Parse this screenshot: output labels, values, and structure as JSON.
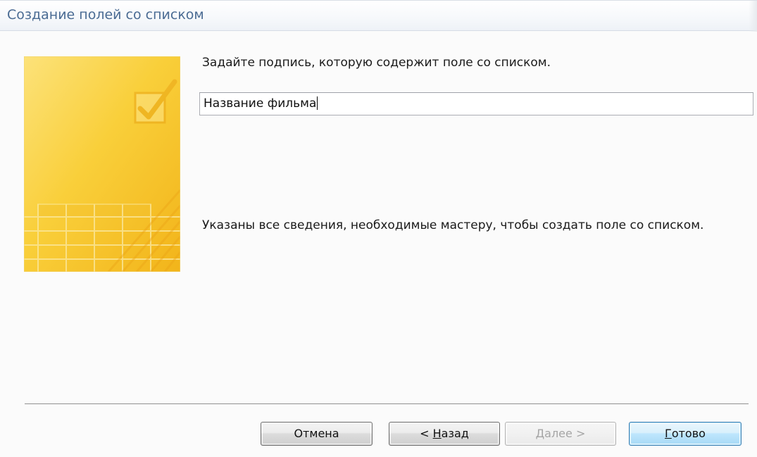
{
  "window": {
    "title": "Создание полей со списком"
  },
  "main": {
    "prompt": "Задайте подпись, которую содержит поле со списком.",
    "caption_input": {
      "value": "Название фильма"
    },
    "info": "Указаны все сведения, необходимые мастеру, чтобы создать поле со списком."
  },
  "buttons": {
    "cancel": {
      "label": "Отмена"
    },
    "back": {
      "prefix": "< ",
      "accel": "Н",
      "rest": "азад"
    },
    "next": {
      "accel": "Д",
      "rest": "алее >"
    },
    "finish": {
      "accel": "Г",
      "rest": "отово"
    }
  },
  "icons": {
    "wizard_art": "checkbox-table-illustration-icon"
  },
  "colors": {
    "title": "#4a6b93",
    "art_yellow": "#f7c52b",
    "finish_button": "#bee6fd"
  }
}
